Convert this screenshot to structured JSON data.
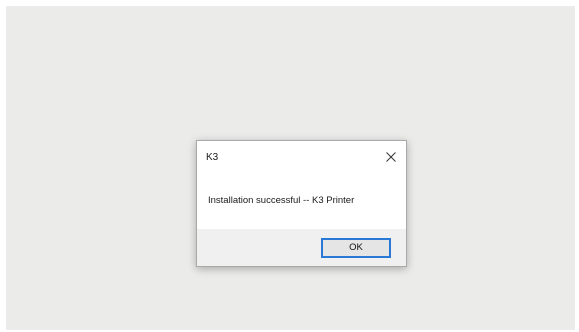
{
  "dialog": {
    "title": "K3",
    "message": "Installation successful -- K3 Printer",
    "ok_label": "OK",
    "close_icon": "close-icon"
  },
  "colors": {
    "desktop_bg": "#ebebea",
    "dialog_bg": "#ffffff",
    "footer_bg": "#f0f0f0",
    "button_focus_border": "#2b79d6"
  }
}
